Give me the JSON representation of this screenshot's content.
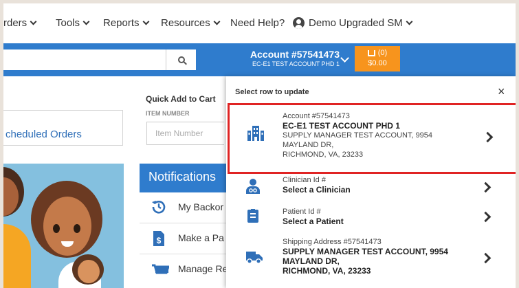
{
  "topnav": {
    "items": [
      {
        "label": "rders"
      },
      {
        "label": "Tools"
      },
      {
        "label": "Reports"
      },
      {
        "label": "Resources"
      },
      {
        "label": "Need Help?"
      },
      {
        "label": "Demo Upgraded SM"
      }
    ]
  },
  "search": {
    "value": "",
    "placeholder": ""
  },
  "account_selector": {
    "number": "Account #57541473",
    "name": "EC-E1 TEST ACCOUNT PHD 1"
  },
  "cart": {
    "count": "(0)",
    "total": "$0.00"
  },
  "left": {
    "scheduled_orders": "cheduled Orders",
    "quick_add": {
      "title": "Quick Add to Cart",
      "label": "ITEM NUMBER",
      "placeholder": "Item Number"
    },
    "notifications": {
      "title": "Notifications",
      "items": [
        {
          "label": "My Backor"
        },
        {
          "label": "Make a Pa"
        },
        {
          "label": "Manage Re"
        }
      ]
    }
  },
  "panel": {
    "title": "Select row to update",
    "close": "×",
    "rows": {
      "account": {
        "label": "Account #57541473",
        "name": "EC-E1 TEST ACCOUNT PHD 1",
        "line1": "SUPPLY MANAGER TEST ACCOUNT, 9954",
        "line2": "MAYLAND DR,",
        "line3": "RICHMOND, VA, 23233"
      },
      "clinician": {
        "label": "Clinician Id #",
        "value": "Select a Clinician"
      },
      "patient": {
        "label": "Patient Id #",
        "value": "Select a Patient"
      },
      "shipping": {
        "label": "Shipping Address #57541473",
        "line1": "SUPPLY MANAGER TEST ACCOUNT, 9954",
        "line2": "MAYLAND DR,",
        "line3": "RICHMOND, VA, 23233"
      }
    }
  },
  "colors": {
    "brand_blue": "#2f7ccd",
    "cart_orange": "#f7941d",
    "highlight_red": "#e02424"
  },
  "icons": [
    "chevron-down-icon",
    "user-circle-icon",
    "search-icon",
    "cart-icon",
    "building-icon",
    "clinician-icon",
    "patient-badge-icon",
    "truck-icon",
    "history-icon",
    "payment-icon",
    "manage-icon",
    "close-icon",
    "chevron-right-icon"
  ]
}
